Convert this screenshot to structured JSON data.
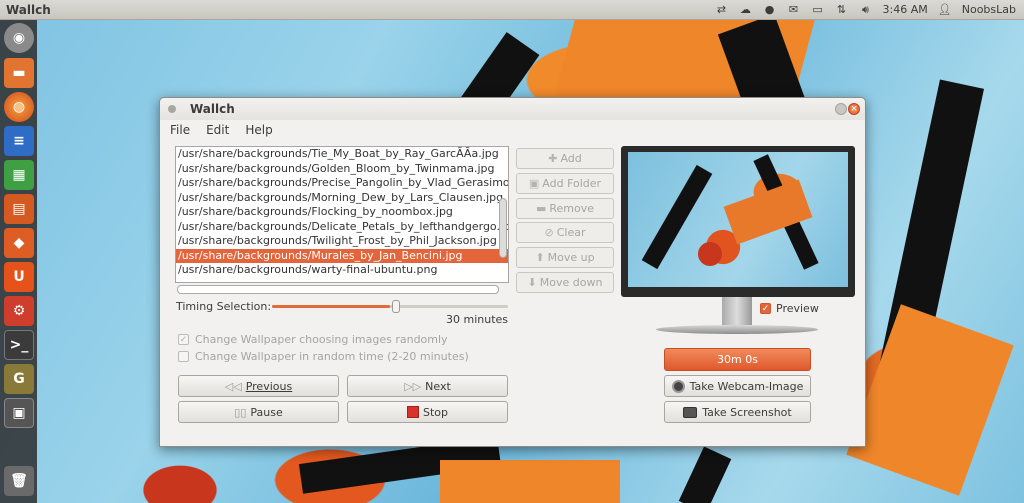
{
  "top_panel": {
    "app_title": "Wallch",
    "time": "3:46 AM",
    "user": "NoobsLab",
    "icons": [
      "network-icon",
      "cloud-icon",
      "chat-icon",
      "mail-icon",
      "battery-icon",
      "transfer-icon",
      "volume-icon",
      "user-icon"
    ]
  },
  "launcher": {
    "items": [
      "ubuntu-icon",
      "files-icon",
      "firefox-icon",
      "writer-icon",
      "calc-icon",
      "impress-icon",
      "software-center-icon",
      "ubuntu-one-icon",
      "settings-icon",
      "terminal-icon",
      "gimp-icon",
      "workspace-icon",
      "trash-icon"
    ]
  },
  "window": {
    "title": "Wallch",
    "menu": [
      "File",
      "Edit",
      "Help"
    ],
    "files": [
      "/usr/share/backgrounds/Tie_My_Boat_by_Ray_GarcÃ­Ãa.jpg",
      "/usr/share/backgrounds/Golden_Bloom_by_Twinmama.jpg",
      "/usr/share/backgrounds/Precise_Pangolin_by_Vlad_Gerasimov",
      "/usr/share/backgrounds/Morning_Dew_by_Lars_Clausen.jpg",
      "/usr/share/backgrounds/Flocking_by_noombox.jpg",
      "/usr/share/backgrounds/Delicate_Petals_by_lefthandgergo.jpg",
      "/usr/share/backgrounds/Twilight_Frost_by_Phil_Jackson.jpg",
      "/usr/share/backgrounds/Murales_by_Jan_Bencini.jpg",
      "/usr/share/backgrounds/warty-final-ubuntu.png"
    ],
    "selected_index": 7,
    "actions": {
      "add": "Add",
      "add_folder": "Add Folder",
      "remove": "Remove",
      "clear": "Clear",
      "move_up": "Move up",
      "move_down": "Move down"
    },
    "timing": {
      "label": "Timing Selection:",
      "value": "30 minutes",
      "slider_fraction": 0.5
    },
    "options": {
      "random_images": "Change Wallpaper choosing images randomly",
      "random_images_checked": true,
      "random_time": "Change Wallpaper in random time (2-20 minutes)",
      "random_time_checked": false
    },
    "controls": {
      "previous": "Previous",
      "next": "Next",
      "pause": "Pause",
      "stop": "Stop"
    },
    "preview": {
      "label": "Preview",
      "checked": true
    },
    "countdown": "30m 0s",
    "webcam": "Take Webcam-Image",
    "screenshot": "Take Screenshot"
  },
  "colors": {
    "accent": "#e4653b",
    "panel": "#d6d3cc",
    "launcher": "#2d2d2d"
  }
}
